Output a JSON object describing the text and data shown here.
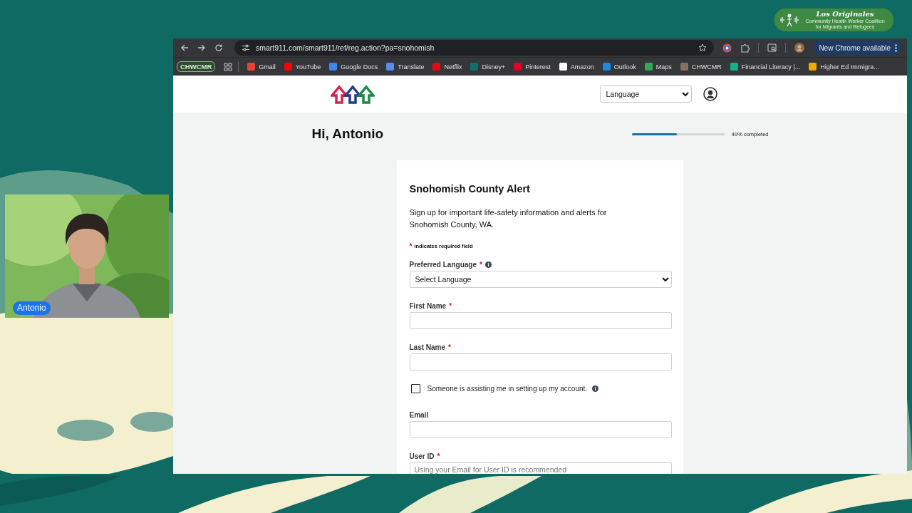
{
  "overlay_logo": {
    "title": "Los Originales",
    "subtitle": "Community Health Worker Coalition for Migrants and Refugees"
  },
  "webcam": {
    "kind": "picture",
    "name_tag": "Antonio"
  },
  "browser": {
    "url": "smart911.com/smart911/ref/reg.action?pa=snohomish",
    "update_button": "New Chrome available",
    "bookmarks": [
      {
        "label": "CHWCMR",
        "kind": "group"
      },
      {
        "label": "Gmail",
        "kind": "bookmark"
      },
      {
        "label": "YouTube",
        "kind": "bookmark"
      },
      {
        "label": "Google Docs",
        "kind": "bookmark"
      },
      {
        "label": "Translate",
        "kind": "bookmark"
      },
      {
        "label": "Netflix",
        "kind": "bookmark"
      },
      {
        "label": "Disney+",
        "kind": "bookmark"
      },
      {
        "label": "Pinterest",
        "kind": "bookmark"
      },
      {
        "label": "Amazon",
        "kind": "bookmark"
      },
      {
        "label": "Outlook",
        "kind": "bookmark"
      },
      {
        "label": "Maps",
        "kind": "bookmark"
      },
      {
        "label": "CHWCMR",
        "kind": "bookmark"
      },
      {
        "label": "Financial Literacy |...",
        "kind": "bookmark"
      },
      {
        "label": "Higher Ed Immigra...",
        "kind": "bookmark"
      }
    ]
  },
  "site_header": {
    "language_select": "Language"
  },
  "greeting": "Hi, Antonio",
  "progress": {
    "level": 0.49,
    "label": "49% completed"
  },
  "form": {
    "title": "Snohomish County Alert",
    "description": "Sign up for important life-safety information and alerts for Snohomish County, WA.",
    "required_mark": "*",
    "required_note": "indicates required field",
    "fields": [
      {
        "kind": "select",
        "label": "Preferred Language",
        "required": true,
        "info": true,
        "value": "Select Language"
      },
      {
        "kind": "text",
        "label": "First Name",
        "required": true,
        "info": false
      },
      {
        "kind": "text",
        "label": "Last Name",
        "required": true,
        "info": false
      },
      {
        "kind": "checkbox",
        "label": "Someone is assisting me in setting up my account.",
        "checked": false,
        "info": true
      },
      {
        "kind": "text",
        "label": "Email",
        "required": false,
        "info": false
      },
      {
        "kind": "text",
        "label": "User ID",
        "required": true,
        "info": false,
        "placeholder": "Using your Email for User ID is recommended"
      }
    ]
  }
}
